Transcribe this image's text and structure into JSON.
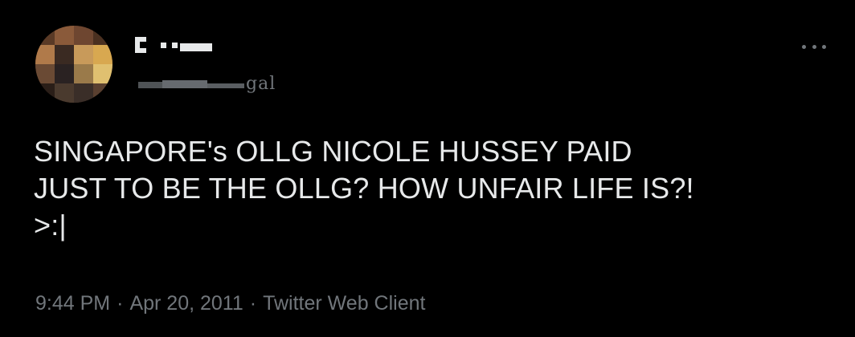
{
  "author": {
    "display_name": "C ·",
    "handle_visible_tail": "gal",
    "avatar_icon": "profile-photo-icon",
    "more_icon": "more-horizontal-icon"
  },
  "tweet": {
    "lines": [
      "SINGAPORE's OLLG NICOLE HUSSEY PAID",
      "JUST TO BE THE OLLG? HOW UNFAIR LIFE IS?!",
      ">:|"
    ]
  },
  "meta": {
    "time": "9:44 PM",
    "separator": "·",
    "date": "Apr 20, 2011",
    "client": "Twitter Web Client"
  },
  "colors": {
    "background": "#000000",
    "primary_text": "#e7e9ea",
    "secondary_text": "#71767b"
  }
}
